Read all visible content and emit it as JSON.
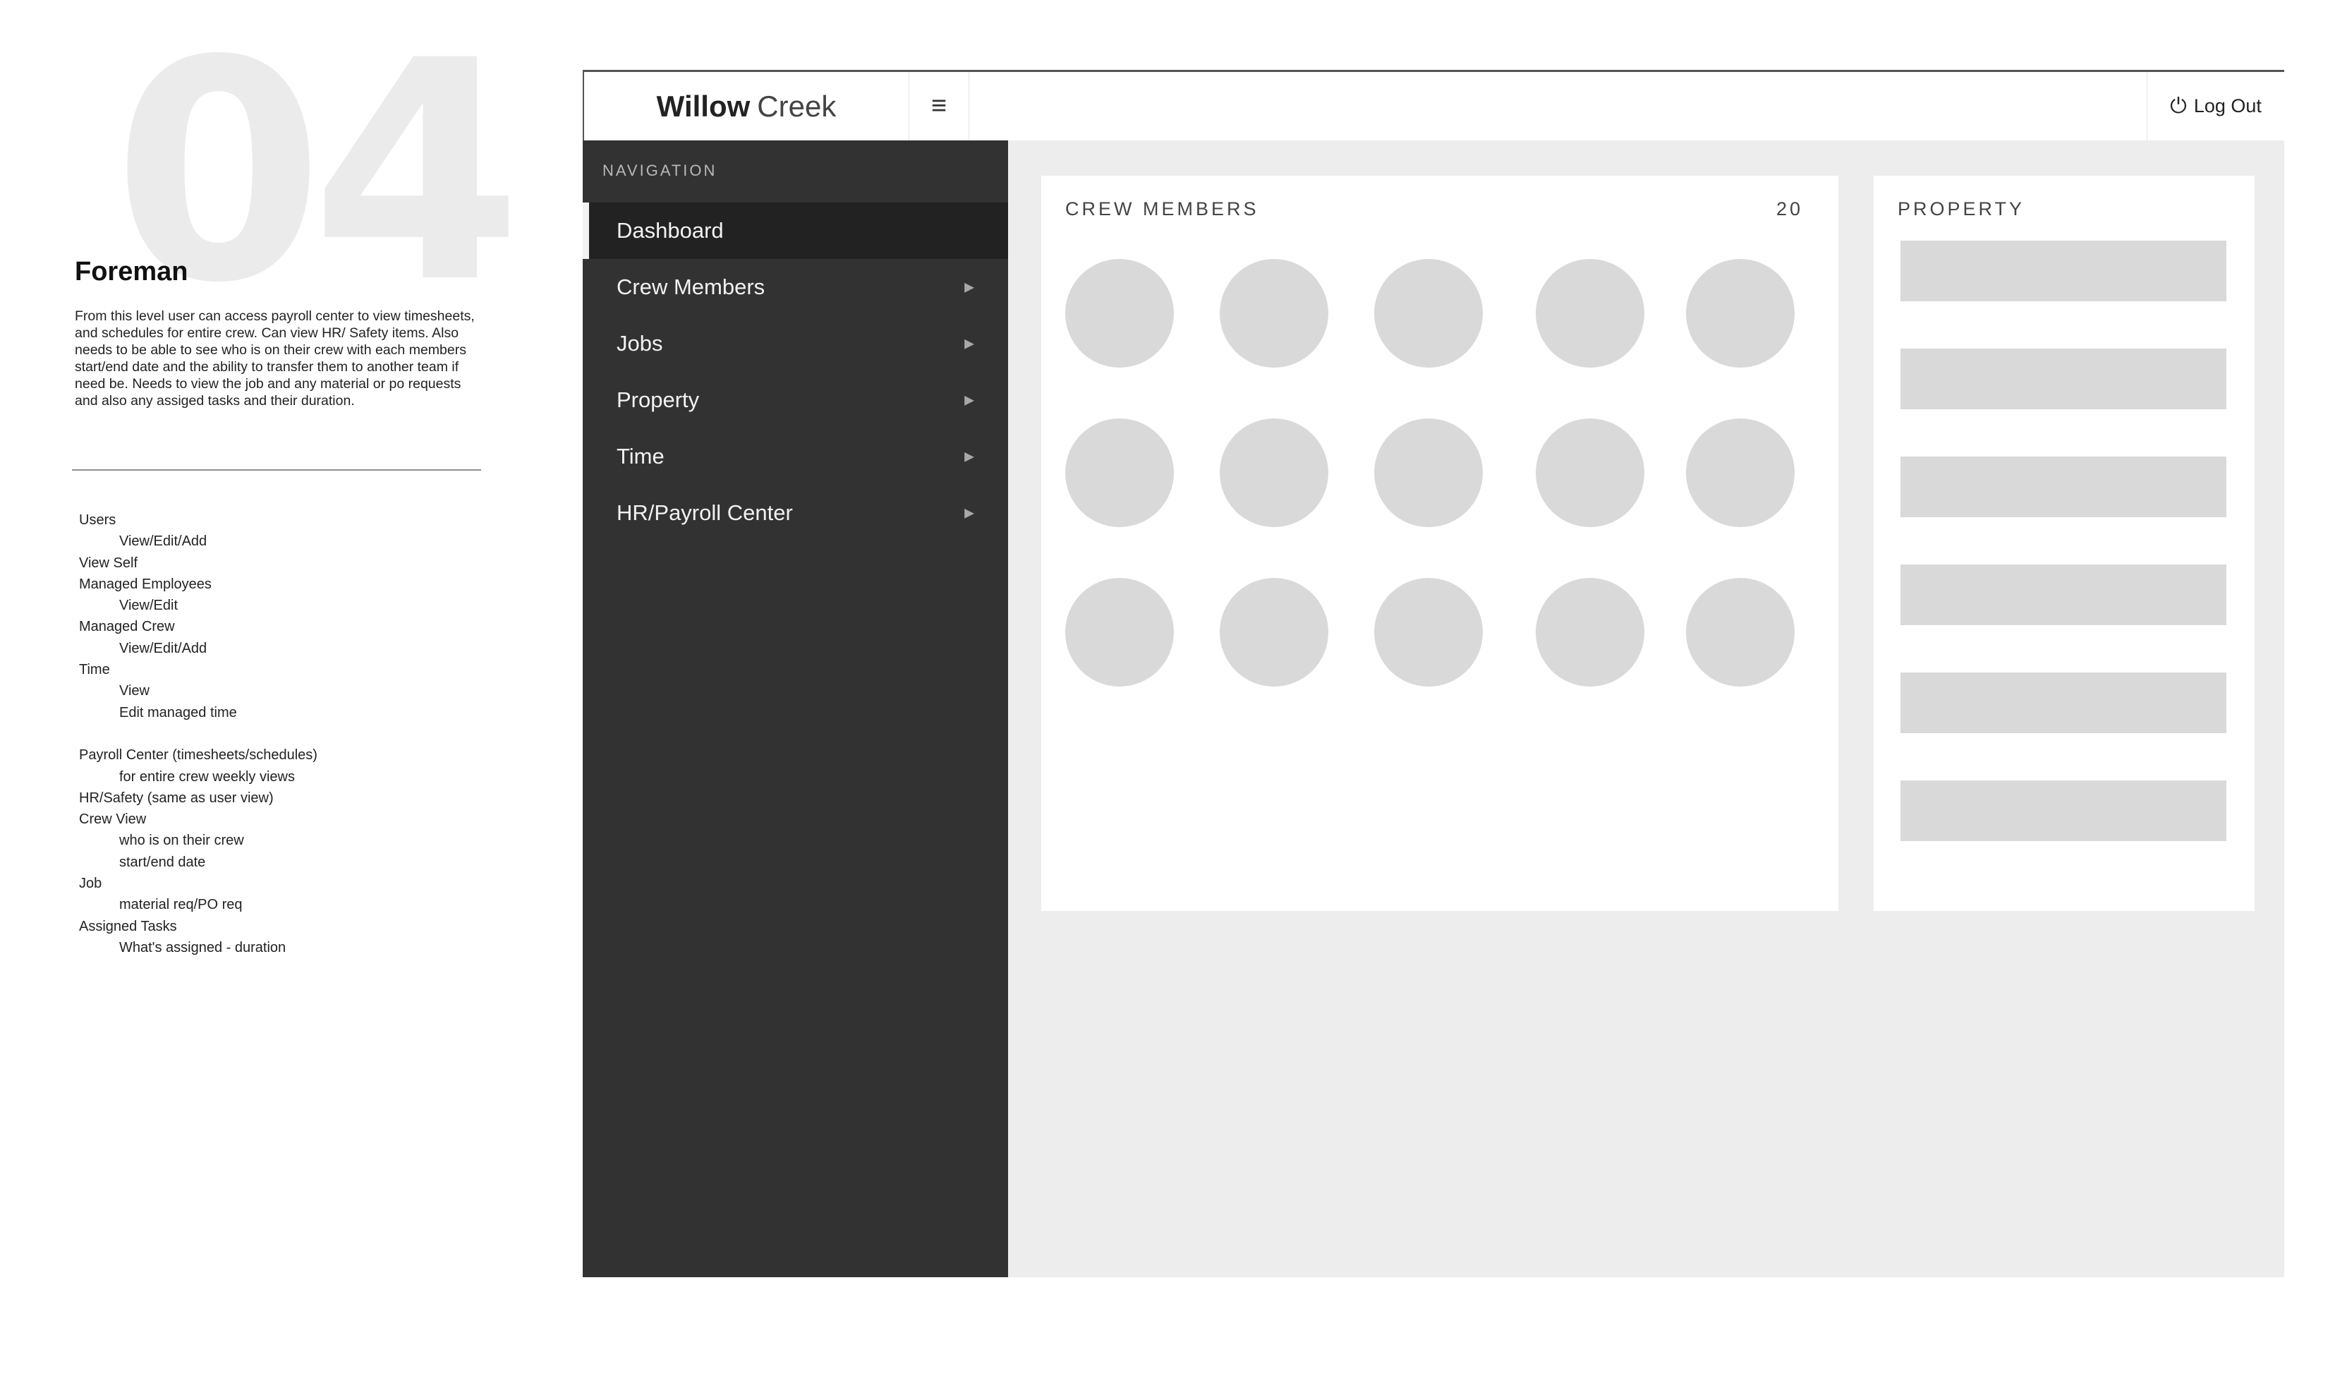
{
  "annotation": {
    "number": "04",
    "role": "Foreman",
    "description": "From this level user can access payroll center to view timesheets, and schedules for entire crew. Can view HR/ Safety items. Also needs to be able to see who is on their crew with each members start/end date and the ability to transfer them to another team if need be. Needs to view the job and any material or po requests and also any assiged tasks and their duration.",
    "permissions": [
      {
        "text": "Users",
        "indent": false
      },
      {
        "text": "View/Edit/Add",
        "indent": true
      },
      {
        "text": "View Self",
        "indent": false
      },
      {
        "text": "Managed Employees",
        "indent": false
      },
      {
        "text": "View/Edit",
        "indent": true
      },
      {
        "text": "Managed Crew",
        "indent": false
      },
      {
        "text": "View/Edit/Add",
        "indent": true
      },
      {
        "text": "Time",
        "indent": false
      },
      {
        "text": "View",
        "indent": true
      },
      {
        "text": "Edit managed time",
        "indent": true
      },
      {
        "text": "",
        "indent": false,
        "gap": true
      },
      {
        "text": "Payroll Center (timesheets/schedules)",
        "indent": false
      },
      {
        "text": "for entire crew weekly views",
        "indent": true
      },
      {
        "text": "HR/Safety (same as user view)",
        "indent": false
      },
      {
        "text": "Crew View",
        "indent": false
      },
      {
        "text": "who is on their crew",
        "indent": true
      },
      {
        "text": "start/end date",
        "indent": true
      },
      {
        "text": "Job",
        "indent": false
      },
      {
        "text": "material req/PO req",
        "indent": true
      },
      {
        "text": "Assigned Tasks",
        "indent": false
      },
      {
        "text": "What's assigned - duration",
        "indent": true
      }
    ]
  },
  "header": {
    "brand_bold": "Willow",
    "brand_light": "Creek",
    "menu_icon": "hamburger-icon",
    "logout_label": "Log Out",
    "logout_icon": "power-icon"
  },
  "sidebar": {
    "heading": "NAVIGATION",
    "items": [
      {
        "label": "Dashboard",
        "active": true,
        "has_arrow": false,
        "name": "dashboard"
      },
      {
        "label": "Crew Members",
        "active": false,
        "has_arrow": true,
        "name": "crew-members"
      },
      {
        "label": "Jobs",
        "active": false,
        "has_arrow": true,
        "name": "jobs"
      },
      {
        "label": "Property",
        "active": false,
        "has_arrow": true,
        "name": "property"
      },
      {
        "label": "Time",
        "active": false,
        "has_arrow": true,
        "name": "time"
      },
      {
        "label": "HR/Payroll Center",
        "active": false,
        "has_arrow": true,
        "name": "hr-payroll-center"
      }
    ]
  },
  "crew_card": {
    "heading": "CREW MEMBERS",
    "count": "20",
    "avatar_count": 15
  },
  "property_card": {
    "heading": "PROPERTY",
    "placeholder_count": 6
  },
  "colors": {
    "sidebar_bg": "#323232",
    "active_item_bg": "#222222",
    "content_bg": "#ededed",
    "placeholder": "#d9d9d9"
  }
}
